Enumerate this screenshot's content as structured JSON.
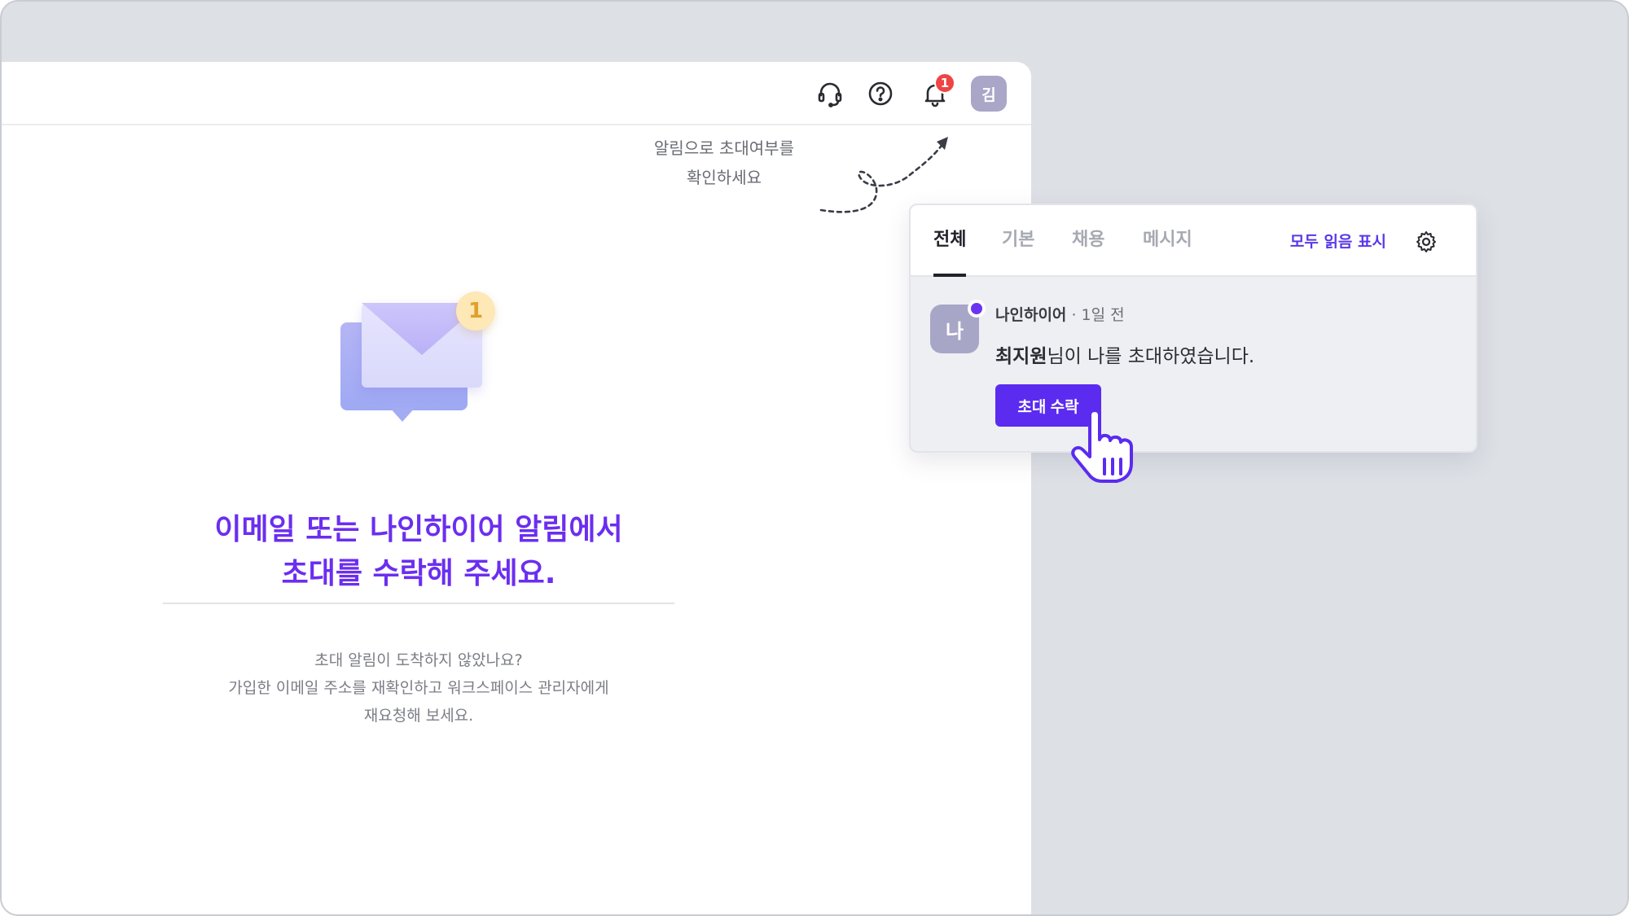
{
  "topbar": {
    "avatar_initial": "김",
    "notification_count": "1",
    "icons": [
      "headset-icon",
      "help-circle-icon",
      "bell-icon"
    ]
  },
  "illustration": {
    "badge_count": "1"
  },
  "main": {
    "headline_line1": "이메일 또는 나인하이어 알림에서",
    "headline_line2": "초대를 수락해 주세요.",
    "help_line1": "초대 알림이 도착하지 않았나요?",
    "help_line2": "가입한 이메일 주소를 재확인하고 워크스페이스 관리자에게",
    "help_line3": "재요청해 보세요."
  },
  "hint": {
    "line1": "알림으로 초대여부를",
    "line2": "확인하세요"
  },
  "notifications": {
    "tabs": [
      {
        "label": "전체",
        "active": true
      },
      {
        "label": "기본",
        "active": false
      },
      {
        "label": "채용",
        "active": false
      },
      {
        "label": "메시지",
        "active": false
      }
    ],
    "mark_all_read": "모두 읽음 표시",
    "item": {
      "avatar_initial": "나",
      "sender": "나인하이어",
      "separator": "·",
      "time": "1일 전",
      "message_bold": "최지원",
      "message_rest": "님이 나를 초대하였습니다.",
      "action_label": "초대 수락"
    }
  },
  "colors": {
    "accent": "#5b2bf0",
    "headline": "#6b2ef0",
    "badge_red": "#ef4444",
    "backdrop": "#dde0e5"
  }
}
